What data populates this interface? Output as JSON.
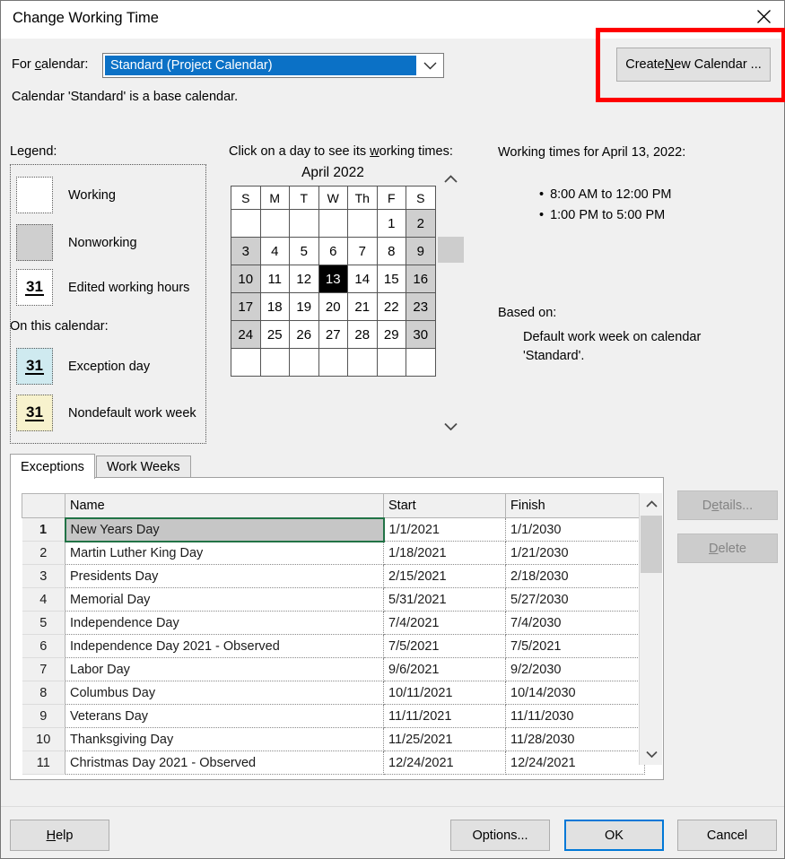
{
  "window": {
    "title": "Change Working Time",
    "close_icon": "close-icon"
  },
  "top": {
    "for_calendar_label_pre": "For ",
    "for_calendar_label_accel": "c",
    "for_calendar_label_post": "alendar:",
    "calendar_value": "Standard (Project Calendar)",
    "dropdown_icon": "chevron-down-icon",
    "base_calendar_note": "Calendar 'Standard' is a base calendar.",
    "create_new_calendar_pre": "Create ",
    "create_new_calendar_accel": "N",
    "create_new_calendar_post": "ew Calendar ..."
  },
  "legend": {
    "label": "Legend:",
    "items": [
      {
        "swatch": "working",
        "glyph": "",
        "label": "Working"
      },
      {
        "swatch": "nonworking",
        "glyph": "",
        "label": "Nonworking"
      },
      {
        "swatch": "edited",
        "glyph": "31",
        "label": "Edited working hours"
      }
    ],
    "on_this_calendar_label": "On this calendar:",
    "cal_items": [
      {
        "swatch": "exception",
        "glyph": "31",
        "label": "Exception day"
      },
      {
        "swatch": "nondefault",
        "glyph": "31",
        "label": "Nondefault work week"
      }
    ]
  },
  "calendar": {
    "hint_pre": "Click on a day to see its ",
    "hint_accel": "w",
    "hint_post": "orking times:",
    "month_title": "April 2022",
    "weekday_headers": [
      "S",
      "M",
      "T",
      "W",
      "Th",
      "F",
      "S"
    ],
    "weeks": [
      [
        {
          "d": "",
          "t": "blank"
        },
        {
          "d": "",
          "t": "blank"
        },
        {
          "d": "",
          "t": "blank"
        },
        {
          "d": "",
          "t": "blank"
        },
        {
          "d": "",
          "t": "blank"
        },
        {
          "d": "1",
          "t": "work"
        },
        {
          "d": "2",
          "t": "off"
        }
      ],
      [
        {
          "d": "3",
          "t": "off"
        },
        {
          "d": "4",
          "t": "work"
        },
        {
          "d": "5",
          "t": "work"
        },
        {
          "d": "6",
          "t": "work"
        },
        {
          "d": "7",
          "t": "work"
        },
        {
          "d": "8",
          "t": "work"
        },
        {
          "d": "9",
          "t": "off"
        }
      ],
      [
        {
          "d": "10",
          "t": "off"
        },
        {
          "d": "11",
          "t": "work"
        },
        {
          "d": "12",
          "t": "work"
        },
        {
          "d": "13",
          "t": "sel"
        },
        {
          "d": "14",
          "t": "work"
        },
        {
          "d": "15",
          "t": "work"
        },
        {
          "d": "16",
          "t": "off"
        }
      ],
      [
        {
          "d": "17",
          "t": "off"
        },
        {
          "d": "18",
          "t": "work"
        },
        {
          "d": "19",
          "t": "work"
        },
        {
          "d": "20",
          "t": "work"
        },
        {
          "d": "21",
          "t": "work"
        },
        {
          "d": "22",
          "t": "work"
        },
        {
          "d": "23",
          "t": "off"
        }
      ],
      [
        {
          "d": "24",
          "t": "off"
        },
        {
          "d": "25",
          "t": "work"
        },
        {
          "d": "26",
          "t": "work"
        },
        {
          "d": "27",
          "t": "work"
        },
        {
          "d": "28",
          "t": "work"
        },
        {
          "d": "29",
          "t": "work"
        },
        {
          "d": "30",
          "t": "off"
        }
      ],
      [
        {
          "d": "",
          "t": "blank"
        },
        {
          "d": "",
          "t": "blank"
        },
        {
          "d": "",
          "t": "blank"
        },
        {
          "d": "",
          "t": "blank"
        },
        {
          "d": "",
          "t": "blank"
        },
        {
          "d": "",
          "t": "blank"
        },
        {
          "d": "",
          "t": "blank"
        }
      ]
    ],
    "scroll_up_icon": "chevron-up-icon",
    "scroll_down_icon": "chevron-down-icon"
  },
  "working_times": {
    "title": "Working times for April 13, 2022:",
    "entries": [
      "8:00 AM to 12:00 PM",
      "1:00 PM to 5:00 PM"
    ],
    "based_on_label": "Based on:",
    "based_on_value": "Default work week on calendar 'Standard'."
  },
  "tabs": {
    "exceptions": "Exceptions",
    "work_weeks": "Work Weeks"
  },
  "table": {
    "headers": {
      "index": "",
      "name": "Name",
      "start": "Start",
      "finish": "Finish"
    },
    "rows": [
      {
        "idx": "1",
        "name": "New Years Day",
        "start": "1/1/2021",
        "finish": "1/1/2030"
      },
      {
        "idx": "2",
        "name": "Martin Luther King Day",
        "start": "1/18/2021",
        "finish": "1/21/2030"
      },
      {
        "idx": "3",
        "name": "Presidents Day",
        "start": "2/15/2021",
        "finish": "2/18/2030"
      },
      {
        "idx": "4",
        "name": "Memorial Day",
        "start": "5/31/2021",
        "finish": "5/27/2030"
      },
      {
        "idx": "5",
        "name": "Independence Day",
        "start": "7/4/2021",
        "finish": "7/4/2030"
      },
      {
        "idx": "6",
        "name": "Independence Day 2021 - Observed",
        "start": "7/5/2021",
        "finish": "7/5/2021"
      },
      {
        "idx": "7",
        "name": "Labor Day",
        "start": "9/6/2021",
        "finish": "9/2/2030"
      },
      {
        "idx": "8",
        "name": "Columbus Day",
        "start": "10/11/2021",
        "finish": "10/14/2030"
      },
      {
        "idx": "9",
        "name": "Veterans Day",
        "start": "11/11/2021",
        "finish": "11/11/2030"
      },
      {
        "idx": "10",
        "name": "Thanksgiving Day",
        "start": "11/25/2021",
        "finish": "11/28/2030"
      },
      {
        "idx": "11",
        "name": "Christmas Day 2021 - Observed",
        "start": "12/24/2021",
        "finish": "12/24/2021"
      }
    ],
    "selected_row_index": 0,
    "scroll_up_icon": "chevron-up-icon",
    "scroll_down_icon": "chevron-down-icon"
  },
  "side_buttons": {
    "details_pre": "D",
    "details_accel": "e",
    "details_post": "tails...",
    "details_disabled": true,
    "delete_pre": "",
    "delete_accel": "D",
    "delete_post": "elete",
    "delete_disabled": true
  },
  "footer": {
    "help_pre": "",
    "help_accel": "H",
    "help_post": "elp",
    "options": "Options...",
    "ok": "OK",
    "cancel": "Cancel"
  },
  "colors": {
    "accent_blue": "#0b71c6",
    "focus_blue": "#0078d7",
    "highlight_red": "#ff0000",
    "selection_green": "#217346",
    "nonworking_gray": "#cfcfcf",
    "exception_cyan": "#cfeaf0",
    "nondefault_yellow": "#f7f2cd"
  }
}
